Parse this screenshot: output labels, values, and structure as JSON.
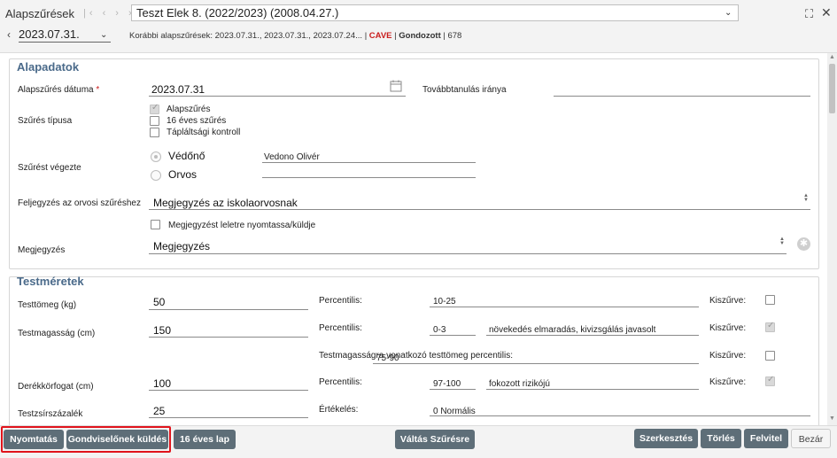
{
  "header": {
    "title": "Alapszűrések",
    "patient": "Teszt Elek 8. (2022/2023) (2008.04.27.)",
    "date": "2023.07.31.",
    "previous_label": "Korábbi alapszűrések:",
    "previous_dates": "2023.07.31., 2023.07.31., 2023.07.24...",
    "sep1": "|",
    "cave": "CAVE",
    "sep2": "|",
    "gondozott": "Gondozott",
    "gondozott_suffix": "| 678"
  },
  "alapadatok": {
    "title": "Alapadatok",
    "date_label": "Alapszűrés dátuma",
    "required_mark": "*",
    "date_value": "2023.07.31",
    "tovabb_label": "Továbbtanulás iránya",
    "tovabb_value": "",
    "type_label": "Szűrés típusa",
    "types": [
      {
        "label": "Alapszűrés",
        "checked": true
      },
      {
        "label": "16 éves szűrés",
        "checked": false
      },
      {
        "label": "Tápláltsági kontroll",
        "checked": false
      }
    ],
    "performed_label": "Szűrést végezte",
    "vedono_label": "Védőnő",
    "vedono_name": "Vedono Olivér",
    "orvos_label": "Orvos",
    "orvos_name": "",
    "note_doc_label": "Feljegyzés az orvosi szűréshez",
    "note_doc_value": "Megjegyzés az iskolaorvosnak",
    "print_label": "Megjegyzést leletre nyomtassa/küldje",
    "remark_label": "Megjegyzés",
    "remark_value": "Megjegyzés"
  },
  "testmeretek": {
    "title": "Testméretek",
    "percentilis_label": "Percentilis:",
    "kiszurve_label": "Kiszűrve:",
    "rows": [
      {
        "label": "Testtömeg (kg)",
        "value": "50",
        "percentile": "10-25",
        "extra": "",
        "kiszurve": false
      },
      {
        "label": "Testmagasság (cm)",
        "value": "150",
        "percentile": "0-3",
        "extra": "növekedés elmaradás, kivizsgálás javasolt",
        "kiszurve": true
      },
      {
        "label": "Derékkörfogat (cm)",
        "value": "100",
        "percentile": "97-100",
        "extra": "fokozott rizikójú",
        "kiszurve": true
      }
    ],
    "weight_for_height_label": "Testmagasságra vonatkozó testtömeg percentilis:",
    "weight_for_height_value": "75-90",
    "weight_for_height_kiszurve": false,
    "bodyfat_label": "Testzsírszázalék",
    "bodyfat_value": "25",
    "ertekeles_label": "Értékelés:",
    "ertekeles_value": "0 Normális"
  },
  "buttons": {
    "print": "Nyomtatás",
    "send_guardian": "Gondviselőnek küldés",
    "sixteen": "16 éves lap",
    "switch": "Váltás Szűrésre",
    "edit": "Szerkesztés",
    "delete": "Törlés",
    "record": "Felvitel",
    "close": "Bezár"
  },
  "icons": {
    "nav": "first-prev-next-last-icons",
    "calendar": "calendar-icon",
    "gear": "gear-icon",
    "expand": "expand-icon",
    "close": "close-icon"
  },
  "colors": {
    "accent": "#4a6a8a",
    "button": "#5e6e78",
    "cave": "#c91d1d",
    "highlight": "#e0141c"
  }
}
